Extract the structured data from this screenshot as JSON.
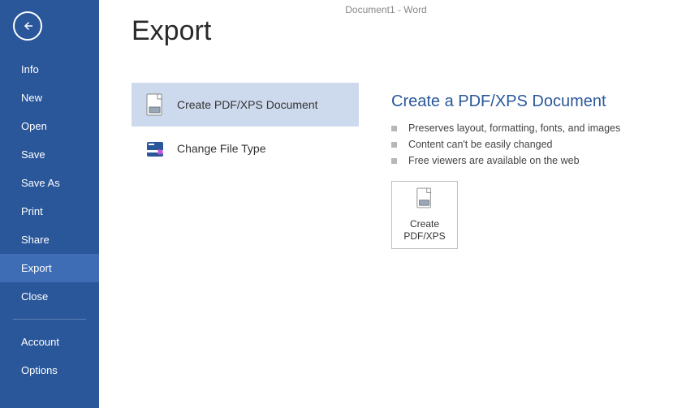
{
  "app_title": "Document1 - Word",
  "page_title": "Export",
  "sidebar": {
    "items": [
      {
        "label": "Info"
      },
      {
        "label": "New"
      },
      {
        "label": "Open"
      },
      {
        "label": "Save"
      },
      {
        "label": "Save As"
      },
      {
        "label": "Print"
      },
      {
        "label": "Share"
      },
      {
        "label": "Export"
      },
      {
        "label": "Close"
      }
    ],
    "footer": [
      {
        "label": "Account"
      },
      {
        "label": "Options"
      }
    ]
  },
  "export_options": [
    {
      "label": "Create PDF/XPS Document"
    },
    {
      "label": "Change File Type"
    }
  ],
  "detail": {
    "title": "Create a PDF/XPS Document",
    "bullets": [
      "Preserves layout, formatting, fonts, and images",
      "Content can't be easily changed",
      "Free viewers are available on the web"
    ],
    "button_line1": "Create",
    "button_line2": "PDF/XPS"
  }
}
